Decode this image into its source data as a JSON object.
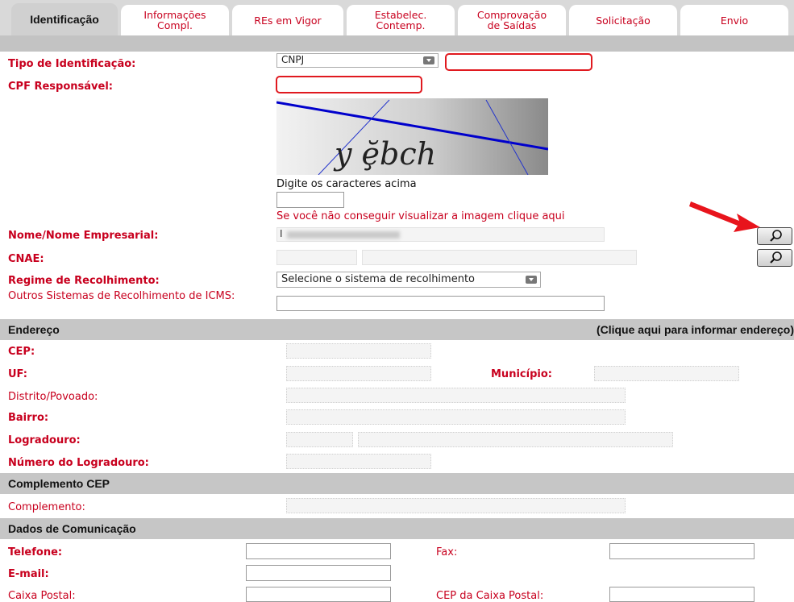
{
  "tabs": [
    {
      "label": "Identificação"
    },
    {
      "label": "Informações\nCompl."
    },
    {
      "label": "REs em Vigor"
    },
    {
      "label": "Estabelec.\nContemp."
    },
    {
      "label": "Comprovação\nde Saídas"
    },
    {
      "label": "Solicitação"
    },
    {
      "label": "Envio"
    }
  ],
  "identificacao": {
    "tipo_label": "Tipo de Identificação:",
    "tipo_value": "CNPJ",
    "cpf_label": "CPF Responsável:",
    "captcha_instr": "Digite os caracteres acima",
    "captcha_link": "Se você não conseguir visualizar a imagem clique aqui",
    "nome_label": "Nome/Nome Empresarial:",
    "nome_value": "I",
    "cnae_label": "CNAE:",
    "regime_label": "Regime de Recolhimento:",
    "regime_value": "Selecione o sistema de recolhimento",
    "outros_label": "Outros Sistemas de Recolhimento de ICMS:"
  },
  "endereco": {
    "title": "Endereço",
    "link": "(Clique aqui para informar endereço)",
    "cep_label": "CEP:",
    "uf_label": "UF:",
    "municipio_label": "Município:",
    "distrito_label": "Distrito/Povoado:",
    "bairro_label": "Bairro:",
    "logradouro_label": "Logradouro:",
    "numero_label": "Número do Logradouro:"
  },
  "complemento": {
    "title": "Complemento CEP",
    "label": "Complemento:"
  },
  "comunicacao": {
    "title": "Dados de Comunicação",
    "telefone_label": "Telefone:",
    "fax_label": "Fax:",
    "email_label": "E-mail:",
    "caixa_label": "Caixa Postal:",
    "cep_caixa_label": "CEP da Caixa Postal:"
  },
  "colors": {
    "label_red": "#c8001e",
    "highlight_red": "#e0191f",
    "arrow_red": "#e8141c",
    "section_gray": "#c6c6c6"
  }
}
